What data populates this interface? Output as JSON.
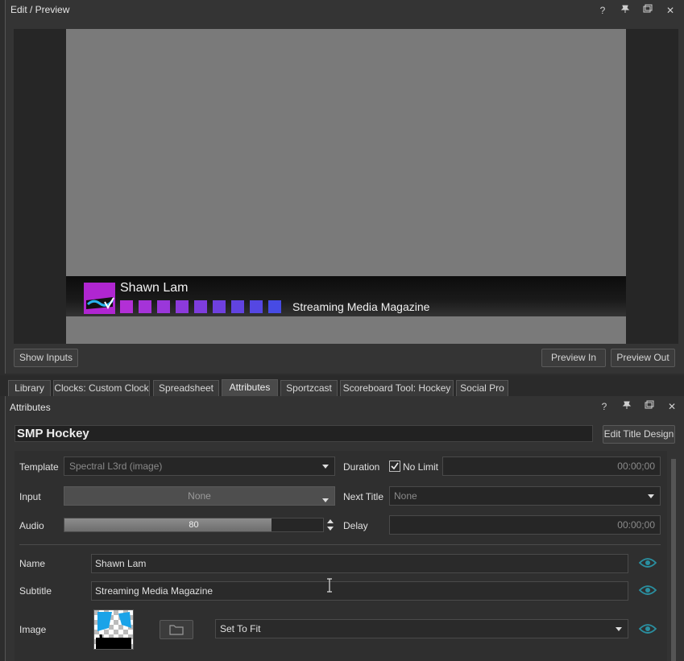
{
  "edit_panel": {
    "title": "Edit / Preview",
    "icons": [
      "help-icon",
      "pin-icon",
      "float-window-icon",
      "close-icon"
    ],
    "lower_third": {
      "name": "Shawn Lam",
      "subtitle": "Streaming Media Magazine",
      "square_colors": [
        "#b22fd6",
        "#a533d8",
        "#9a37da",
        "#8c3adb",
        "#7e3ddd",
        "#6f40df",
        "#6143e0",
        "#5547e2",
        "#474be4"
      ],
      "logo_color": "#b026d1"
    },
    "buttons": {
      "show_inputs": "Show Inputs",
      "preview_in": "Preview In",
      "preview_out": "Preview Out"
    }
  },
  "tabs": [
    {
      "label": "Library"
    },
    {
      "label": "Clocks: Custom Clock"
    },
    {
      "label": "Spreadsheet"
    },
    {
      "label": "Attributes",
      "active": true
    },
    {
      "label": "Sportzcast"
    },
    {
      "label": "Scoreboard Tool: Hockey"
    },
    {
      "label": "Social Pro"
    }
  ],
  "attributes": {
    "title": "Attributes",
    "title_name": "SMP Hockey",
    "edit_title_design": "Edit Title Design",
    "template_label": "Template",
    "template_value": "Spectral L3rd (image)",
    "duration_label": "Duration",
    "no_limit_label": "No Limit",
    "no_limit_checked": true,
    "duration_value": "00:00;00",
    "input_label": "Input",
    "input_value": "None",
    "next_title_label": "Next Title",
    "next_title_value": "None",
    "audio_label": "Audio",
    "audio_value": "80",
    "audio_level": 0.8,
    "delay_label": "Delay",
    "delay_value": "00:00;00",
    "name_label": "Name",
    "name_value": "Shawn Lam",
    "subtitle_label": "Subtitle",
    "subtitle_value": "Streaming Media Magazine",
    "image_label": "Image",
    "image_fit_value": "Set To Fit",
    "accent_color": "#2a8fa0"
  }
}
